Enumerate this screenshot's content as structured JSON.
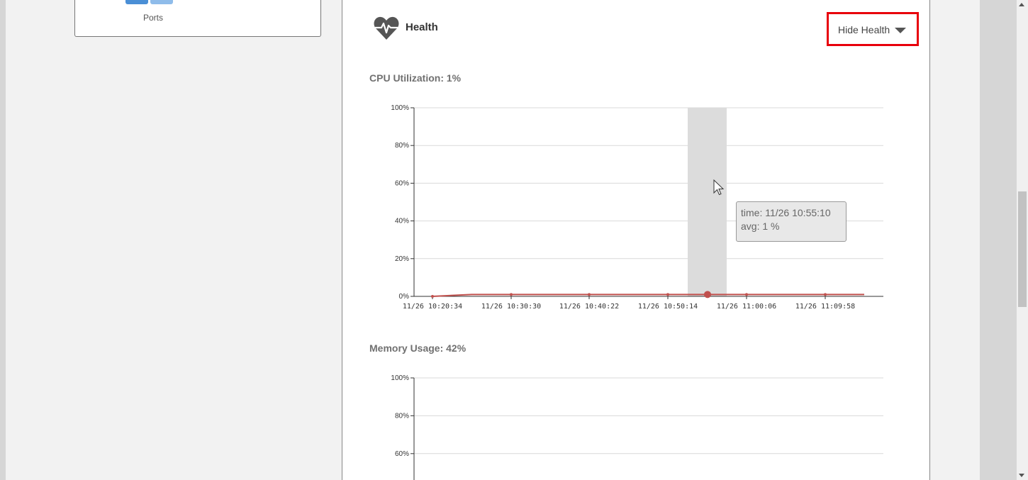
{
  "ports_card": {
    "label": "Ports"
  },
  "health": {
    "title": "Health",
    "hide_button_label": "Hide Health",
    "icons": {
      "health": "heartbeat-icon",
      "caret": "caret-down-icon"
    }
  },
  "cpu": {
    "title": "CPU Utilization: 1%",
    "tooltip": {
      "time": "time: 11/26 10:55:10",
      "avg": "avg:  1 %"
    }
  },
  "memory": {
    "title": "Memory Usage: 42%"
  },
  "colors": {
    "line": "#c0504d",
    "highlight": "#dcdcdc",
    "accent_border": "#e8000b"
  },
  "chart_data": [
    {
      "type": "line",
      "title": "CPU Utilization: 1%",
      "y_ticks": [
        "100%",
        "80%",
        "60%",
        "40%",
        "20%",
        "0%"
      ],
      "x_ticks": [
        "11/26 10:20:34",
        "11/26 10:30:30",
        "11/26 10:40:22",
        "11/26 10:50:14",
        "11/26 11:00:06",
        "11/26 11:09:58"
      ],
      "ylim": [
        0,
        100
      ],
      "series": [
        {
          "values": [
            0,
            1,
            1,
            1,
            1,
            1,
            1,
            1,
            1,
            1,
            1,
            1
          ]
        }
      ],
      "highlight": {
        "time": "11/26 10:55:10",
        "avg": 1
      },
      "grid": true
    },
    {
      "type": "line",
      "title": "Memory Usage: 42%",
      "y_ticks": [
        "100%",
        "80%",
        "60%"
      ],
      "ylim": [
        0,
        100
      ],
      "grid": true
    }
  ]
}
